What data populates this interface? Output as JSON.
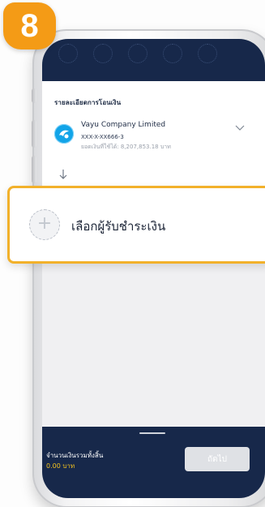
{
  "step_badge": "8",
  "transfer_details": {
    "title": "รายละเอียดการโอนเงิน",
    "account_name": "Vayu Company Limited",
    "account_number": "XXX-X-XX666-3",
    "available_balance": "ยอดเงินที่ใช้ได้: 8,207,853.18 บาท",
    "bank_logo_icon": "bank-logo-icon",
    "expand_icon": "chevron-down-icon",
    "flow_icon": "arrow-down-icon"
  },
  "payee": {
    "label": "เลือกผู้รับชำระเงิน",
    "add_icon": "plus-icon",
    "highlight_color": "#F2B12B"
  },
  "bottom_bar": {
    "total_label": "จำนวนเงินรวมทั้งสิ้น",
    "total_value": "0.00 บาท",
    "next_label": "ถัดไป"
  },
  "colors": {
    "navy": "#17284A",
    "accent_orange": "#F49B16",
    "amount_yellow": "#F4C21F",
    "bank_blue": "#12A4E8"
  }
}
